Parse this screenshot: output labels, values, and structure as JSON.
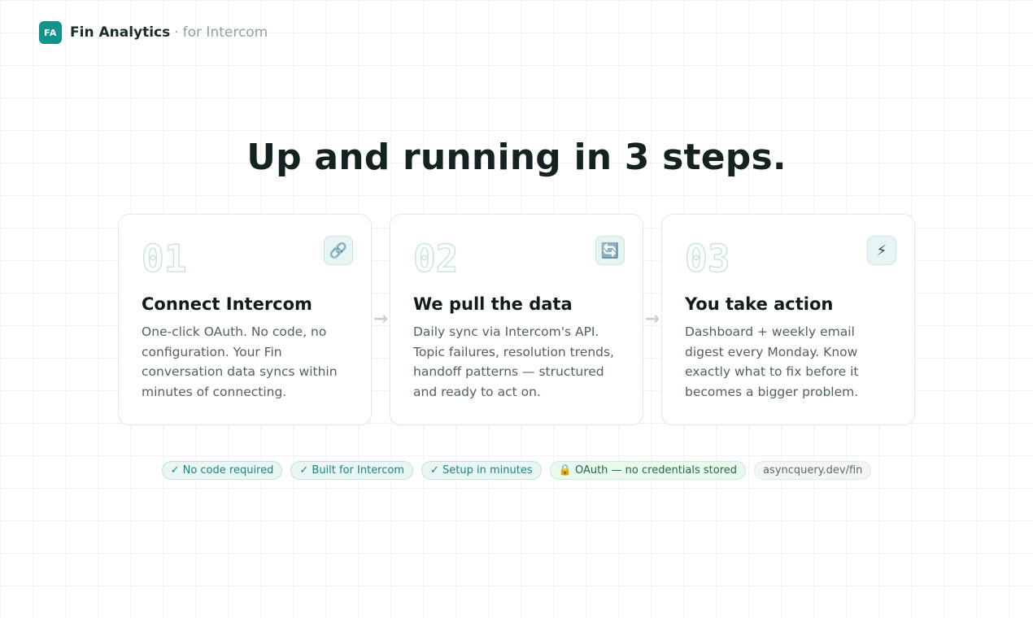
{
  "brand": {
    "logo_text": "FA",
    "name": "Fin Analytics",
    "separator": "·",
    "subtitle": "for Intercom"
  },
  "headline": "Up and running in 3 steps.",
  "steps": [
    {
      "number": "01",
      "icon": "link-icon",
      "icon_glyph": "🔗",
      "title": "Connect Intercom",
      "description": "One-click OAuth. No code, no configuration. Your Fin conversation data syncs within minutes of connecting."
    },
    {
      "number": "02",
      "icon": "sync-icon",
      "icon_glyph": "🔄",
      "title": "We pull the data",
      "description": "Daily sync via Intercom's API. Topic failures, resolution trends, handoff patterns — structured and ready to act on."
    },
    {
      "number": "03",
      "icon": "lightning-icon",
      "icon_glyph": "⚡",
      "title": "You take action",
      "description": "Dashboard + weekly email digest every Monday. Know exactly what to fix before it becomes a bigger problem."
    }
  ],
  "arrow_glyph": "→",
  "badges": [
    {
      "label": "✓ No code required",
      "style": "teal"
    },
    {
      "label": "✓ Built for Intercom",
      "style": "teal"
    },
    {
      "label": "✓ Setup in minutes",
      "style": "teal"
    },
    {
      "label": "🔒 OAuth — no credentials stored",
      "style": "green"
    },
    {
      "label": "asyncquery.dev/fin",
      "style": "gray"
    }
  ],
  "colors": {
    "accent": "#13948a",
    "background_grid": "#f1f4f4",
    "heading": "#142321"
  }
}
